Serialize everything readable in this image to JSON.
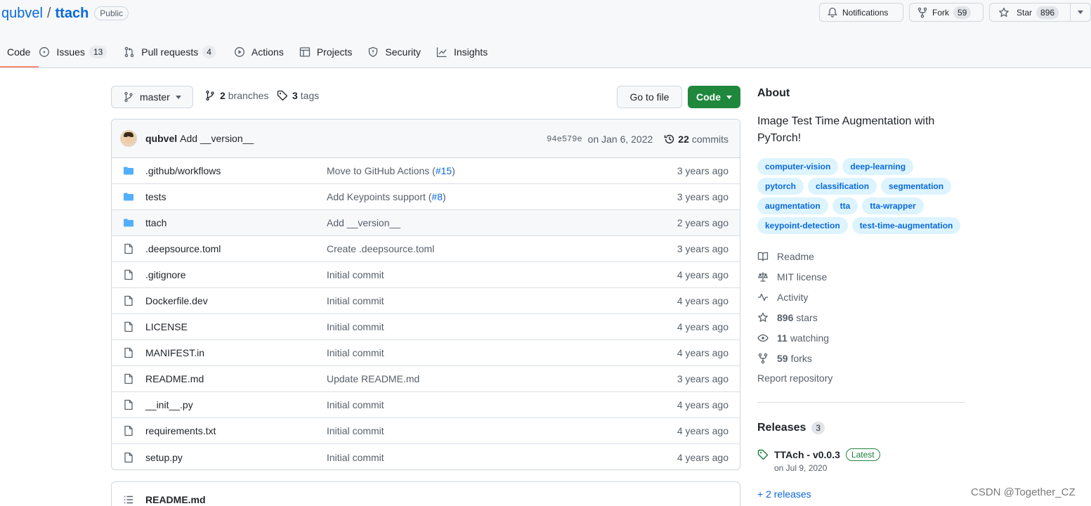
{
  "repo": {
    "owner": "qubvel",
    "separator": "/",
    "name": "ttach",
    "visibility": "Public"
  },
  "header_actions": {
    "notifications_label": "Notifications",
    "fork_label": "Fork",
    "fork_count": "59",
    "star_label": "Star",
    "star_count": "896"
  },
  "tabs": [
    {
      "label": "Code",
      "icon": "code-icon",
      "active": true
    },
    {
      "label": "Issues",
      "icon": "issue-icon",
      "count": "13"
    },
    {
      "label": "Pull requests",
      "icon": "pull-request-icon",
      "count": "4"
    },
    {
      "label": "Actions",
      "icon": "play-icon"
    },
    {
      "label": "Projects",
      "icon": "table-icon"
    },
    {
      "label": "Security",
      "icon": "shield-icon"
    },
    {
      "label": "Insights",
      "icon": "graph-icon"
    }
  ],
  "toolbar": {
    "branch": "master",
    "branches_count": "2",
    "branches_label": "branches",
    "tags_count": "3",
    "tags_label": "tags",
    "goto_file": "Go to file",
    "code_button": "Code"
  },
  "latest_commit": {
    "author": "qubvel",
    "message": "Add __version__",
    "sha": "94e579e",
    "date": "on Jan 6, 2022",
    "commits_count": "22",
    "commits_label": "commits"
  },
  "files": [
    {
      "type": "dir",
      "name": ".github/workflows",
      "message": "Move to GitHub Actions (",
      "pr": "#15",
      "message_end": ")",
      "age": "3 years ago"
    },
    {
      "type": "dir",
      "name": "tests",
      "message": "Add Keypoints support (",
      "pr": "#8",
      "message_end": ")",
      "age": "3 years ago"
    },
    {
      "type": "dir",
      "name": "ttach",
      "message": "Add __version__",
      "age": "2 years ago"
    },
    {
      "type": "file",
      "name": ".deepsource.toml",
      "message": "Create .deepsource.toml",
      "age": "3 years ago"
    },
    {
      "type": "file",
      "name": ".gitignore",
      "message": "Initial commit",
      "age": "4 years ago"
    },
    {
      "type": "file",
      "name": "Dockerfile.dev",
      "message": "Initial commit",
      "age": "4 years ago"
    },
    {
      "type": "file",
      "name": "LICENSE",
      "message": "Initial commit",
      "age": "4 years ago"
    },
    {
      "type": "file",
      "name": "MANIFEST.in",
      "message": "Initial commit",
      "age": "4 years ago"
    },
    {
      "type": "file",
      "name": "README.md",
      "message": "Update README.md",
      "age": "3 years ago"
    },
    {
      "type": "file",
      "name": "__init__.py",
      "message": "Initial commit",
      "age": "4 years ago"
    },
    {
      "type": "file",
      "name": "requirements.txt",
      "message": "Initial commit",
      "age": "4 years ago"
    },
    {
      "type": "file",
      "name": "setup.py",
      "message": "Initial commit",
      "age": "4 years ago"
    }
  ],
  "readme": {
    "title": "README.md"
  },
  "about": {
    "title": "About",
    "description": "Image Test Time Augmentation with PyTorch!",
    "topics": [
      "computer-vision",
      "deep-learning",
      "pytorch",
      "classification",
      "segmentation",
      "augmentation",
      "tta",
      "tta-wrapper",
      "keypoint-detection",
      "test-time-augmentation"
    ],
    "links": [
      {
        "icon": "book-icon",
        "label": "Readme"
      },
      {
        "icon": "law-icon",
        "label": "MIT license"
      },
      {
        "icon": "pulse-icon",
        "label": "Activity"
      },
      {
        "icon": "star-icon",
        "bold": "896",
        "label": "stars"
      },
      {
        "icon": "eye-icon",
        "bold": "11",
        "label": "watching"
      },
      {
        "icon": "fork-icon",
        "bold": "59",
        "label": "forks"
      }
    ],
    "report": "Report repository"
  },
  "releases": {
    "title": "Releases",
    "count": "3",
    "latest_name": "TTAch - v0.0.3",
    "latest_badge": "Latest",
    "latest_date": "on Jul 9, 2020",
    "more": "+ 2 releases"
  },
  "watermark": "CSDN @Together_CZ",
  "colors": {
    "link": "#0969da",
    "primary_button": "#1f883d",
    "tab_underline": "#fd8c73",
    "folder": "#54aeff"
  }
}
